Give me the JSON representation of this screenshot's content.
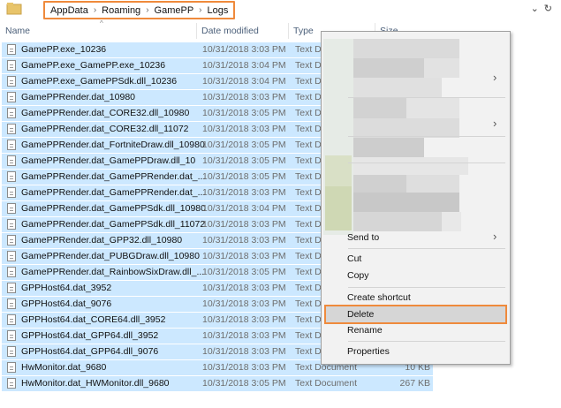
{
  "address_bar": {
    "path": [
      "AppData",
      "Roaming",
      "GamePP",
      "Logs"
    ],
    "separator": "›",
    "dropdown_icon": "chevron-down-icon",
    "refresh_icon": "refresh-icon"
  },
  "columns": {
    "name": "Name",
    "date": "Date modified",
    "type": "Type",
    "size": "Size",
    "sort_indicator": "^"
  },
  "files": [
    {
      "name": "GamePP.exe_10236",
      "date": "10/31/2018 3:03 PM",
      "type": "Text Do",
      "size": ""
    },
    {
      "name": "GamePP.exe_GamePP.exe_10236",
      "date": "10/31/2018 3:04 PM",
      "type": "Text Do",
      "size": ""
    },
    {
      "name": "GamePP.exe_GamePPSdk.dll_10236",
      "date": "10/31/2018 3:04 PM",
      "type": "Text Do",
      "size": ""
    },
    {
      "name": "GamePPRender.dat_10980",
      "date": "10/31/2018 3:03 PM",
      "type": "Text Do",
      "size": ""
    },
    {
      "name": "GamePPRender.dat_CORE32.dll_10980",
      "date": "10/31/2018 3:05 PM",
      "type": "Text Do",
      "size": ""
    },
    {
      "name": "GamePPRender.dat_CORE32.dll_11072",
      "date": "10/31/2018 3:03 PM",
      "type": "Text Do",
      "size": ""
    },
    {
      "name": "GamePPRender.dat_FortniteDraw.dll_10980",
      "date": "10/31/2018 3:05 PM",
      "type": "Text Do",
      "size": ""
    },
    {
      "name": "GamePPRender.dat_GamePPDraw.dll_10",
      "date": "10/31/2018 3:05 PM",
      "type": "Text Do",
      "size": ""
    },
    {
      "name": "GamePPRender.dat_GamePPRender.dat_...",
      "date": "10/31/2018 3:05 PM",
      "type": "Text Do",
      "size": ""
    },
    {
      "name": "GamePPRender.dat_GamePPRender.dat_...",
      "date": "10/31/2018 3:03 PM",
      "type": "Text Do",
      "size": ""
    },
    {
      "name": "GamePPRender.dat_GamePPSdk.dll_10980",
      "date": "10/31/2018 3:04 PM",
      "type": "Text Do",
      "size": ""
    },
    {
      "name": "GamePPRender.dat_GamePPSdk.dll_11072",
      "date": "10/31/2018 3:03 PM",
      "type": "Text Do",
      "size": ""
    },
    {
      "name": "GamePPRender.dat_GPP32.dll_10980",
      "date": "10/31/2018 3:03 PM",
      "type": "Text Do",
      "size": ""
    },
    {
      "name": "GamePPRender.dat_PUBGDraw.dll_10980",
      "date": "10/31/2018 3:03 PM",
      "type": "Text Do",
      "size": ""
    },
    {
      "name": "GamePPRender.dat_RainbowSixDraw.dll_...",
      "date": "10/31/2018 3:05 PM",
      "type": "Text Do",
      "size": ""
    },
    {
      "name": "GPPHost64.dat_3952",
      "date": "10/31/2018 3:03 PM",
      "type": "Text Do",
      "size": ""
    },
    {
      "name": "GPPHost64.dat_9076",
      "date": "10/31/2018 3:03 PM",
      "type": "Text Do",
      "size": ""
    },
    {
      "name": "GPPHost64.dat_CORE64.dll_3952",
      "date": "10/31/2018 3:03 PM",
      "type": "Text Do",
      "size": ""
    },
    {
      "name": "GPPHost64.dat_GPP64.dll_3952",
      "date": "10/31/2018 3:03 PM",
      "type": "Text Do",
      "size": ""
    },
    {
      "name": "GPPHost64.dat_GPP64.dll_9076",
      "date": "10/31/2018 3:03 PM",
      "type": "Text Do",
      "size": ""
    },
    {
      "name": "HwMonitor.dat_9680",
      "date": "10/31/2018 3:03 PM",
      "type": "Text Document",
      "size": "10 KB"
    },
    {
      "name": "HwMonitor.dat_HWMonitor.dll_9680",
      "date": "10/31/2018 3:05 PM",
      "type": "Text Document",
      "size": "267 KB"
    }
  ],
  "context_menu": {
    "send_to": "Send to",
    "cut": "Cut",
    "copy": "Copy",
    "create_shortcut": "Create shortcut",
    "delete": "Delete",
    "rename": "Rename",
    "properties": "Properties",
    "submenu_icon": "chevron-right-icon",
    "highlight_color": "#ef8a3c"
  },
  "colors": {
    "selection": "#cce8ff",
    "header_text": "#4c607a",
    "accent_outline": "#ef8a3c"
  }
}
